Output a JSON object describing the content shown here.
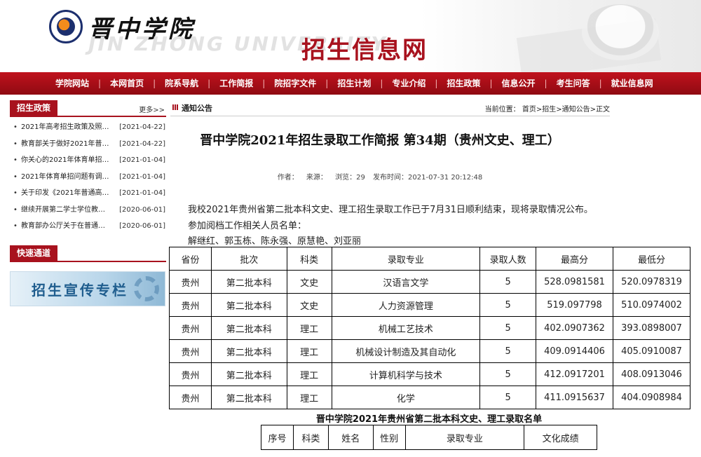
{
  "header": {
    "logo_cn": "晋中学院",
    "logo_en": "JIN ZHONG UNIVERSITY",
    "site_title": "招生信息网"
  },
  "nav": [
    "学院网站",
    "本网首页",
    "院系导航",
    "工作简报",
    "院招字文件",
    "招生计划",
    "专业介绍",
    "招生政策",
    "信息公开",
    "考生问答",
    "就业信息网"
  ],
  "policy": {
    "title": "招生政策",
    "more": "更多>>",
    "items": [
      {
        "text": "2021年高考招生政策及照…",
        "date": "[2021-04-22]"
      },
      {
        "text": "教育部关于做好2021年普…",
        "date": "[2021-04-22]"
      },
      {
        "text": "你关心的2021年体育单招…",
        "date": "[2021-01-04]"
      },
      {
        "text": "2021年体育单招问题有调…",
        "date": "[2021-01-04]"
      },
      {
        "text": "关于印发《2021年普通高…",
        "date": "[2021-01-04]"
      },
      {
        "text": "继续开展第二学士学位教…",
        "date": "[2020-06-01]"
      },
      {
        "text": "教育部办公厅关于在普通…",
        "date": "[2020-06-01]"
      }
    ]
  },
  "quick": {
    "title": "快速通道",
    "banner": "招生宣传专栏"
  },
  "breadcrumb": {
    "title": "通知公告",
    "path": "当前位置： 首页>招生>通知公告>正文"
  },
  "article": {
    "title": "晋中学院2021年招生录取工作简报 第34期（贵州文史、理工）",
    "meta_author": "作者：",
    "meta_source": "来源：",
    "meta_views": "浏览：29",
    "meta_time": "发布时间：2021-07-31 20:12:48",
    "p1": "我校2021年贵州省第二批本科文史、理工招生录取工作已于7月31日顺利结束，现将录取情况公布。",
    "p2": "参加阅档工作相关人员名单：",
    "p3": "解继红、郭玉栋、陈永强、原慧艳、刘亚丽"
  },
  "table1": {
    "headers": [
      "省份",
      "批次",
      "科类",
      "录取专业",
      "录取人数",
      "最高分",
      "最低分"
    ],
    "rows": [
      [
        "贵州",
        "第二批本科",
        "文史",
        "汉语言文学",
        "5",
        "528.0981581",
        "520.0978319"
      ],
      [
        "贵州",
        "第二批本科",
        "文史",
        "人力资源管理",
        "5",
        "519.097798",
        "510.0974002"
      ],
      [
        "贵州",
        "第二批本科",
        "理工",
        "机械工艺技术",
        "5",
        "402.0907362",
        "393.0898007"
      ],
      [
        "贵州",
        "第二批本科",
        "理工",
        "机械设计制造及其自动化",
        "5",
        "409.0914406",
        "405.0910087"
      ],
      [
        "贵州",
        "第二批本科",
        "理工",
        "计算机科学与技术",
        "5",
        "412.0917201",
        "408.0913046"
      ],
      [
        "贵州",
        "第二批本科",
        "理工",
        "化学",
        "5",
        "411.0915637",
        "404.0908984"
      ]
    ]
  },
  "table2": {
    "caption": "晋中学院2021年贵州省第二批本科文史、理工录取名单",
    "headers": [
      "序号",
      "科类",
      "姓名",
      "性别",
      "录取专业",
      "文化成绩"
    ]
  }
}
